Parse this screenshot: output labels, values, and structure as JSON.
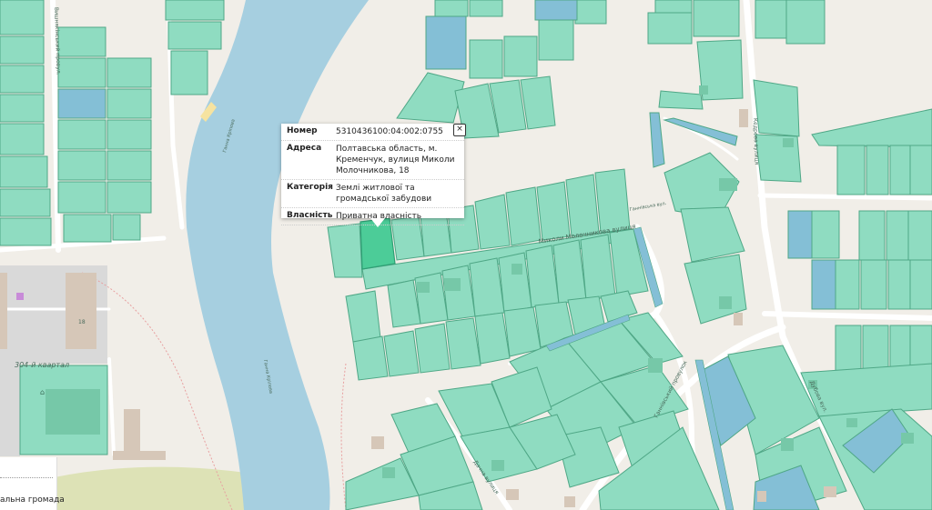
{
  "popup": {
    "rows": [
      {
        "key": "Номер",
        "value": "5310436100:04:002:0755"
      },
      {
        "key": "Адреса",
        "value": "Полтавська область, м. Кременчук, вулиця Миколи Молочникова, 18"
      },
      {
        "key": "Категорія",
        "value": "Землі житлової та громадської забудови"
      },
      {
        "key": "Власність",
        "value": "Приватна власність"
      }
    ],
    "close_label": "×"
  },
  "map": {
    "street_molochnykova": "Миколи Молочникова вулиця",
    "street_left": "Вишнякінський провул.",
    "street_right": "Кедрова вулиця",
    "street_bottom": "Ганнівський провулок",
    "street_bottom2": "Дачна вулиця",
    "street_bottom3": "Дубова вул.",
    "street_small": "Ганнівська вул.",
    "river_label_1": "Ганна Кріпова",
    "river_label_2": "Ганна Кріпова",
    "block_label": "304-й квартал",
    "house_number": "18",
    "colors": {
      "parcel": "#8fdcc1",
      "parcel_stroke": "#4fa786",
      "parcel_blue": "#84bfd6",
      "highlight": "#4ccc98",
      "water": "#a6cfe0",
      "road": "#ffffff",
      "land": "#f1eee8"
    }
  },
  "legend": {
    "text": "альна громада"
  }
}
